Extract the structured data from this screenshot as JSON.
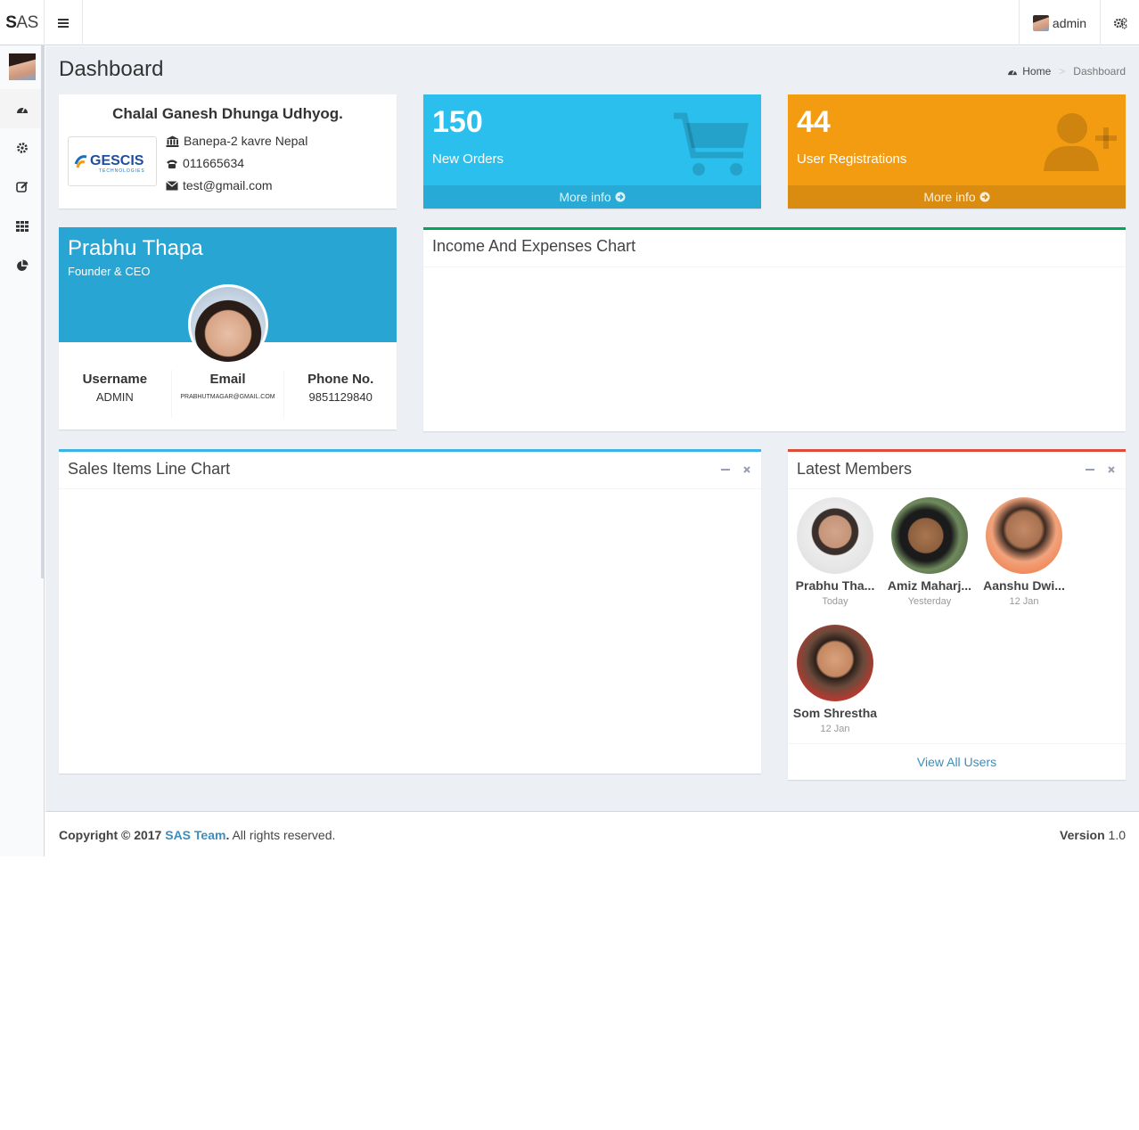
{
  "header": {
    "logo_bold": "S",
    "logo_rest": "AS",
    "user_name": "admin"
  },
  "page": {
    "title": "Dashboard",
    "breadcrumb": {
      "home": "Home",
      "current": "Dashboard"
    }
  },
  "company": {
    "name": "Chalal Ganesh Dhunga Udhyog.",
    "logo_text": "GESCIS",
    "logo_subtext": "TECHNOLOGIES",
    "address": "Banepa-2 kavre Nepal",
    "phone": "011665634",
    "email": "test@gmail.com"
  },
  "stats": [
    {
      "value": "150",
      "label": "New Orders",
      "more": "More info",
      "color": "#2bbfed",
      "footer_color": "#27aad5"
    },
    {
      "value": "44",
      "label": "User Registrations",
      "more": "More info",
      "color": "#f39c12",
      "footer_color": "#da8c10"
    }
  ],
  "profile": {
    "name": "Prabhu Thapa",
    "role": "Founder & CEO",
    "stats": [
      {
        "label": "Username",
        "value": "ADMIN"
      },
      {
        "label": "Email",
        "value": "PRABHUTMAGAR@GMAIL.COM"
      },
      {
        "label": "Phone No.",
        "value": "9851129840"
      }
    ]
  },
  "income_chart": {
    "title": "Income And Expenses Chart",
    "accent": "#00a65a"
  },
  "sales_chart": {
    "title": "Sales Items Line Chart",
    "accent": "#3bb4e5"
  },
  "members": {
    "title": "Latest Members",
    "accent": "#dd4b39",
    "items": [
      {
        "name": "Prabhu Tha...",
        "date": "Today"
      },
      {
        "name": "Amiz Maharj...",
        "date": "Yesterday"
      },
      {
        "name": "Aanshu Dwi...",
        "date": "12 Jan"
      },
      {
        "name": "Som Shrestha",
        "date": "12 Jan"
      }
    ],
    "view_all": "View All Users"
  },
  "footer": {
    "copyright": "Copyright © 2017 ",
    "team": "SAS Team",
    "rights": ". All rights reserved.",
    "version_label": "Version",
    "version": " 1.0"
  }
}
